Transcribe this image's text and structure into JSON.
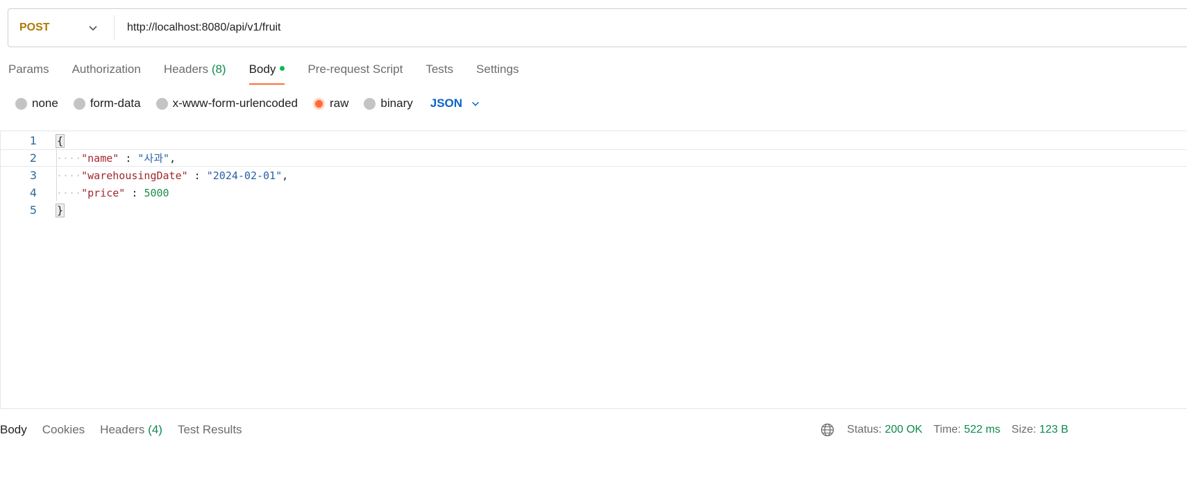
{
  "request": {
    "method": "POST",
    "url": "http://localhost:8080/api/v1/fruit"
  },
  "tabs": [
    {
      "label": "Params"
    },
    {
      "label": "Authorization"
    },
    {
      "label": "Headers",
      "count": "(8)"
    },
    {
      "label": "Body"
    },
    {
      "label": "Pre-request Script"
    },
    {
      "label": "Tests"
    },
    {
      "label": "Settings"
    }
  ],
  "body_types": {
    "options": [
      "none",
      "form-data",
      "x-www-form-urlencoded",
      "raw",
      "binary"
    ],
    "selected": "raw",
    "language": "JSON"
  },
  "editor": {
    "line_numbers": [
      "1",
      "2",
      "3",
      "4",
      "5"
    ],
    "lines": [
      {
        "open_brace": "{"
      },
      {
        "key": "\"name\"",
        "sep": " : ",
        "value": "\"사과\"",
        "trail": ","
      },
      {
        "key": "\"warehousingDate\"",
        "sep": " : ",
        "value": "\"2024-02-01\"",
        "trail": ","
      },
      {
        "key": "\"price\"",
        "sep": " : ",
        "value": "5000",
        "trail": ""
      },
      {
        "close_brace": "}"
      }
    ]
  },
  "response": {
    "tabs": [
      {
        "label": "Body"
      },
      {
        "label": "Cookies"
      },
      {
        "label": "Headers",
        "count": "(4)"
      },
      {
        "label": "Test Results"
      }
    ],
    "status_label": "Status:",
    "status_value": "200 OK",
    "time_label": "Time:",
    "time_value": "522 ms",
    "size_label": "Size:",
    "size_value": "123 B"
  },
  "colors": {
    "accent": "#ff6c37",
    "method": "#ad7a03",
    "success": "#0d8a4a",
    "link_blue": "#0b63c9"
  }
}
